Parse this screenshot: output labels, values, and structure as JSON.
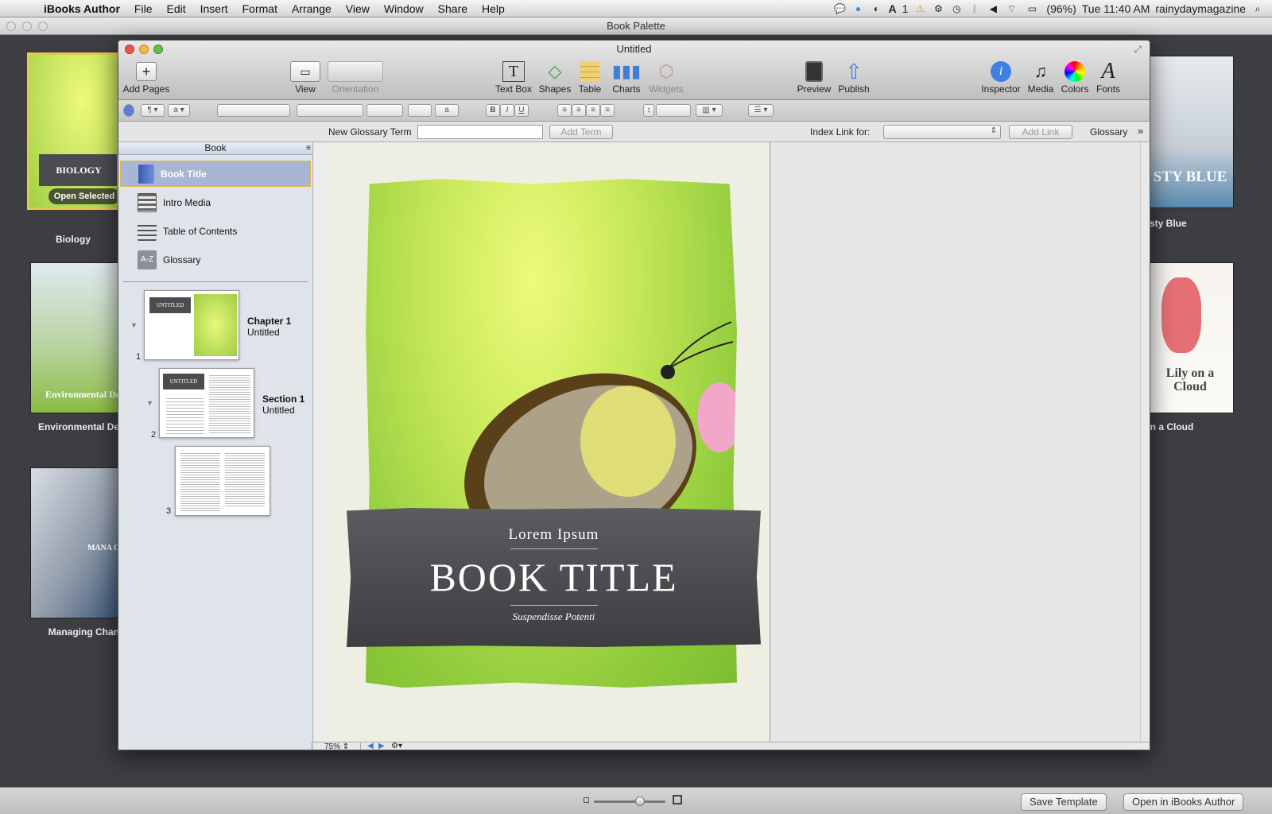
{
  "menubar": {
    "app": "iBooks Author",
    "menus": [
      "File",
      "Edit",
      "Insert",
      "Format",
      "Arrange",
      "View",
      "Window",
      "Share",
      "Help"
    ],
    "adobe_count": "1",
    "battery": "(96%)",
    "clock": "Tue 11:40 AM",
    "user": "rainydaymagazine"
  },
  "palette": {
    "title": "Book Palette",
    "templates": [
      {
        "name": "Biology",
        "cover_title": "BIOLOGY",
        "overlay_button": "Open Selected"
      },
      {
        "name": "Environmental De",
        "cover_title": "Environmental Des"
      },
      {
        "name": "Managing Chan",
        "cover_title": "MANA CH"
      },
      {
        "name": "Dusty Blue",
        "cover_title": "STY BLUE"
      },
      {
        "name": "ly on a Cloud",
        "cover_title": "Lily on a Cloud"
      }
    ],
    "save_template": "Save Template",
    "open_in_author": "Open in iBooks Author"
  },
  "window": {
    "title": "Untitled",
    "toolbar": {
      "add_pages": "Add Pages",
      "view": "View",
      "orientation": "Orientation",
      "text_box": "Text Box",
      "shapes": "Shapes",
      "table": "Table",
      "charts": "Charts",
      "widgets": "Widgets",
      "preview": "Preview",
      "publish": "Publish",
      "inspector": "Inspector",
      "media": "Media",
      "colors": "Colors",
      "fonts": "Fonts"
    },
    "glossary_bar": {
      "new_term_label": "New Glossary Term",
      "add_term": "Add Term",
      "index_link_label": "Index Link for:",
      "add_link": "Add Link",
      "glossary": "Glossary"
    },
    "sidebar": {
      "header": "Book",
      "items": [
        {
          "label": "Book Title",
          "selected": true
        },
        {
          "label": "Intro Media"
        },
        {
          "label": "Table of Contents"
        },
        {
          "label": "Glossary"
        }
      ],
      "pages": [
        {
          "num": "1",
          "title": "Chapter 1",
          "subtitle": "Untitled",
          "thumb_title": "UNTITLED"
        },
        {
          "num": "2",
          "title": "Section 1",
          "subtitle": "Untitled",
          "thumb_title": "UNTITLED"
        },
        {
          "num": "3"
        }
      ]
    },
    "page": {
      "pre_title": "Lorem Ipsum",
      "title": "BOOK TITLE",
      "subtitle": "Suspendisse Potenti"
    },
    "zoom": "75%"
  },
  "colors": {
    "selection": "#a8b6d6",
    "selection_border": "#e8b64a",
    "palette_bg": "#3c3e42",
    "cover_green": "#b9e04f"
  }
}
